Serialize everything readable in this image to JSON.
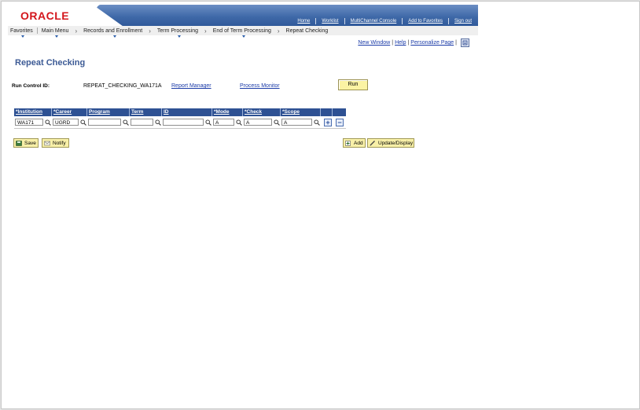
{
  "header": {
    "logo": "ORACLE",
    "top_links": [
      "Home",
      "Worklist",
      "MultiChannel Console",
      "Add to Favorites",
      "Sign out"
    ]
  },
  "nav": {
    "items": [
      "Favorites",
      "Main Menu",
      "Records and Enrollment",
      "Term Processing",
      "End of Term Processing",
      "Repeat Checking"
    ]
  },
  "page_links": {
    "new_window": "New Window",
    "help": "Help",
    "personalize": "Personalize Page"
  },
  "page": {
    "title": "Repeat Checking",
    "run_control_label": "Run Control ID:",
    "run_control_value": "REPEAT_CHECKING_WA171A",
    "report_manager": "Report Manager",
    "process_monitor": "Process Monitor",
    "run_label": "Run"
  },
  "grid": {
    "columns": [
      "*Institution",
      "*Career",
      "Program",
      "Term",
      "ID",
      "*Mode",
      "*Check",
      "*Scope"
    ],
    "row": {
      "institution": "WA171",
      "career": "UGRD",
      "program": "",
      "term": "",
      "id": "",
      "mode": "A",
      "check": "A",
      "scope": "A"
    },
    "add_row": "+",
    "delete_row": "−"
  },
  "buttons": {
    "save": "Save",
    "notify": "Notify",
    "add": "Add",
    "update_display": "Update/Display"
  },
  "colors": {
    "brand_red": "#d4161c",
    "header_blue": "#3f69a8",
    "grid_header": "#2e5193",
    "title_blue": "#3c5a95",
    "button_yellow": "#f8f0a8"
  }
}
